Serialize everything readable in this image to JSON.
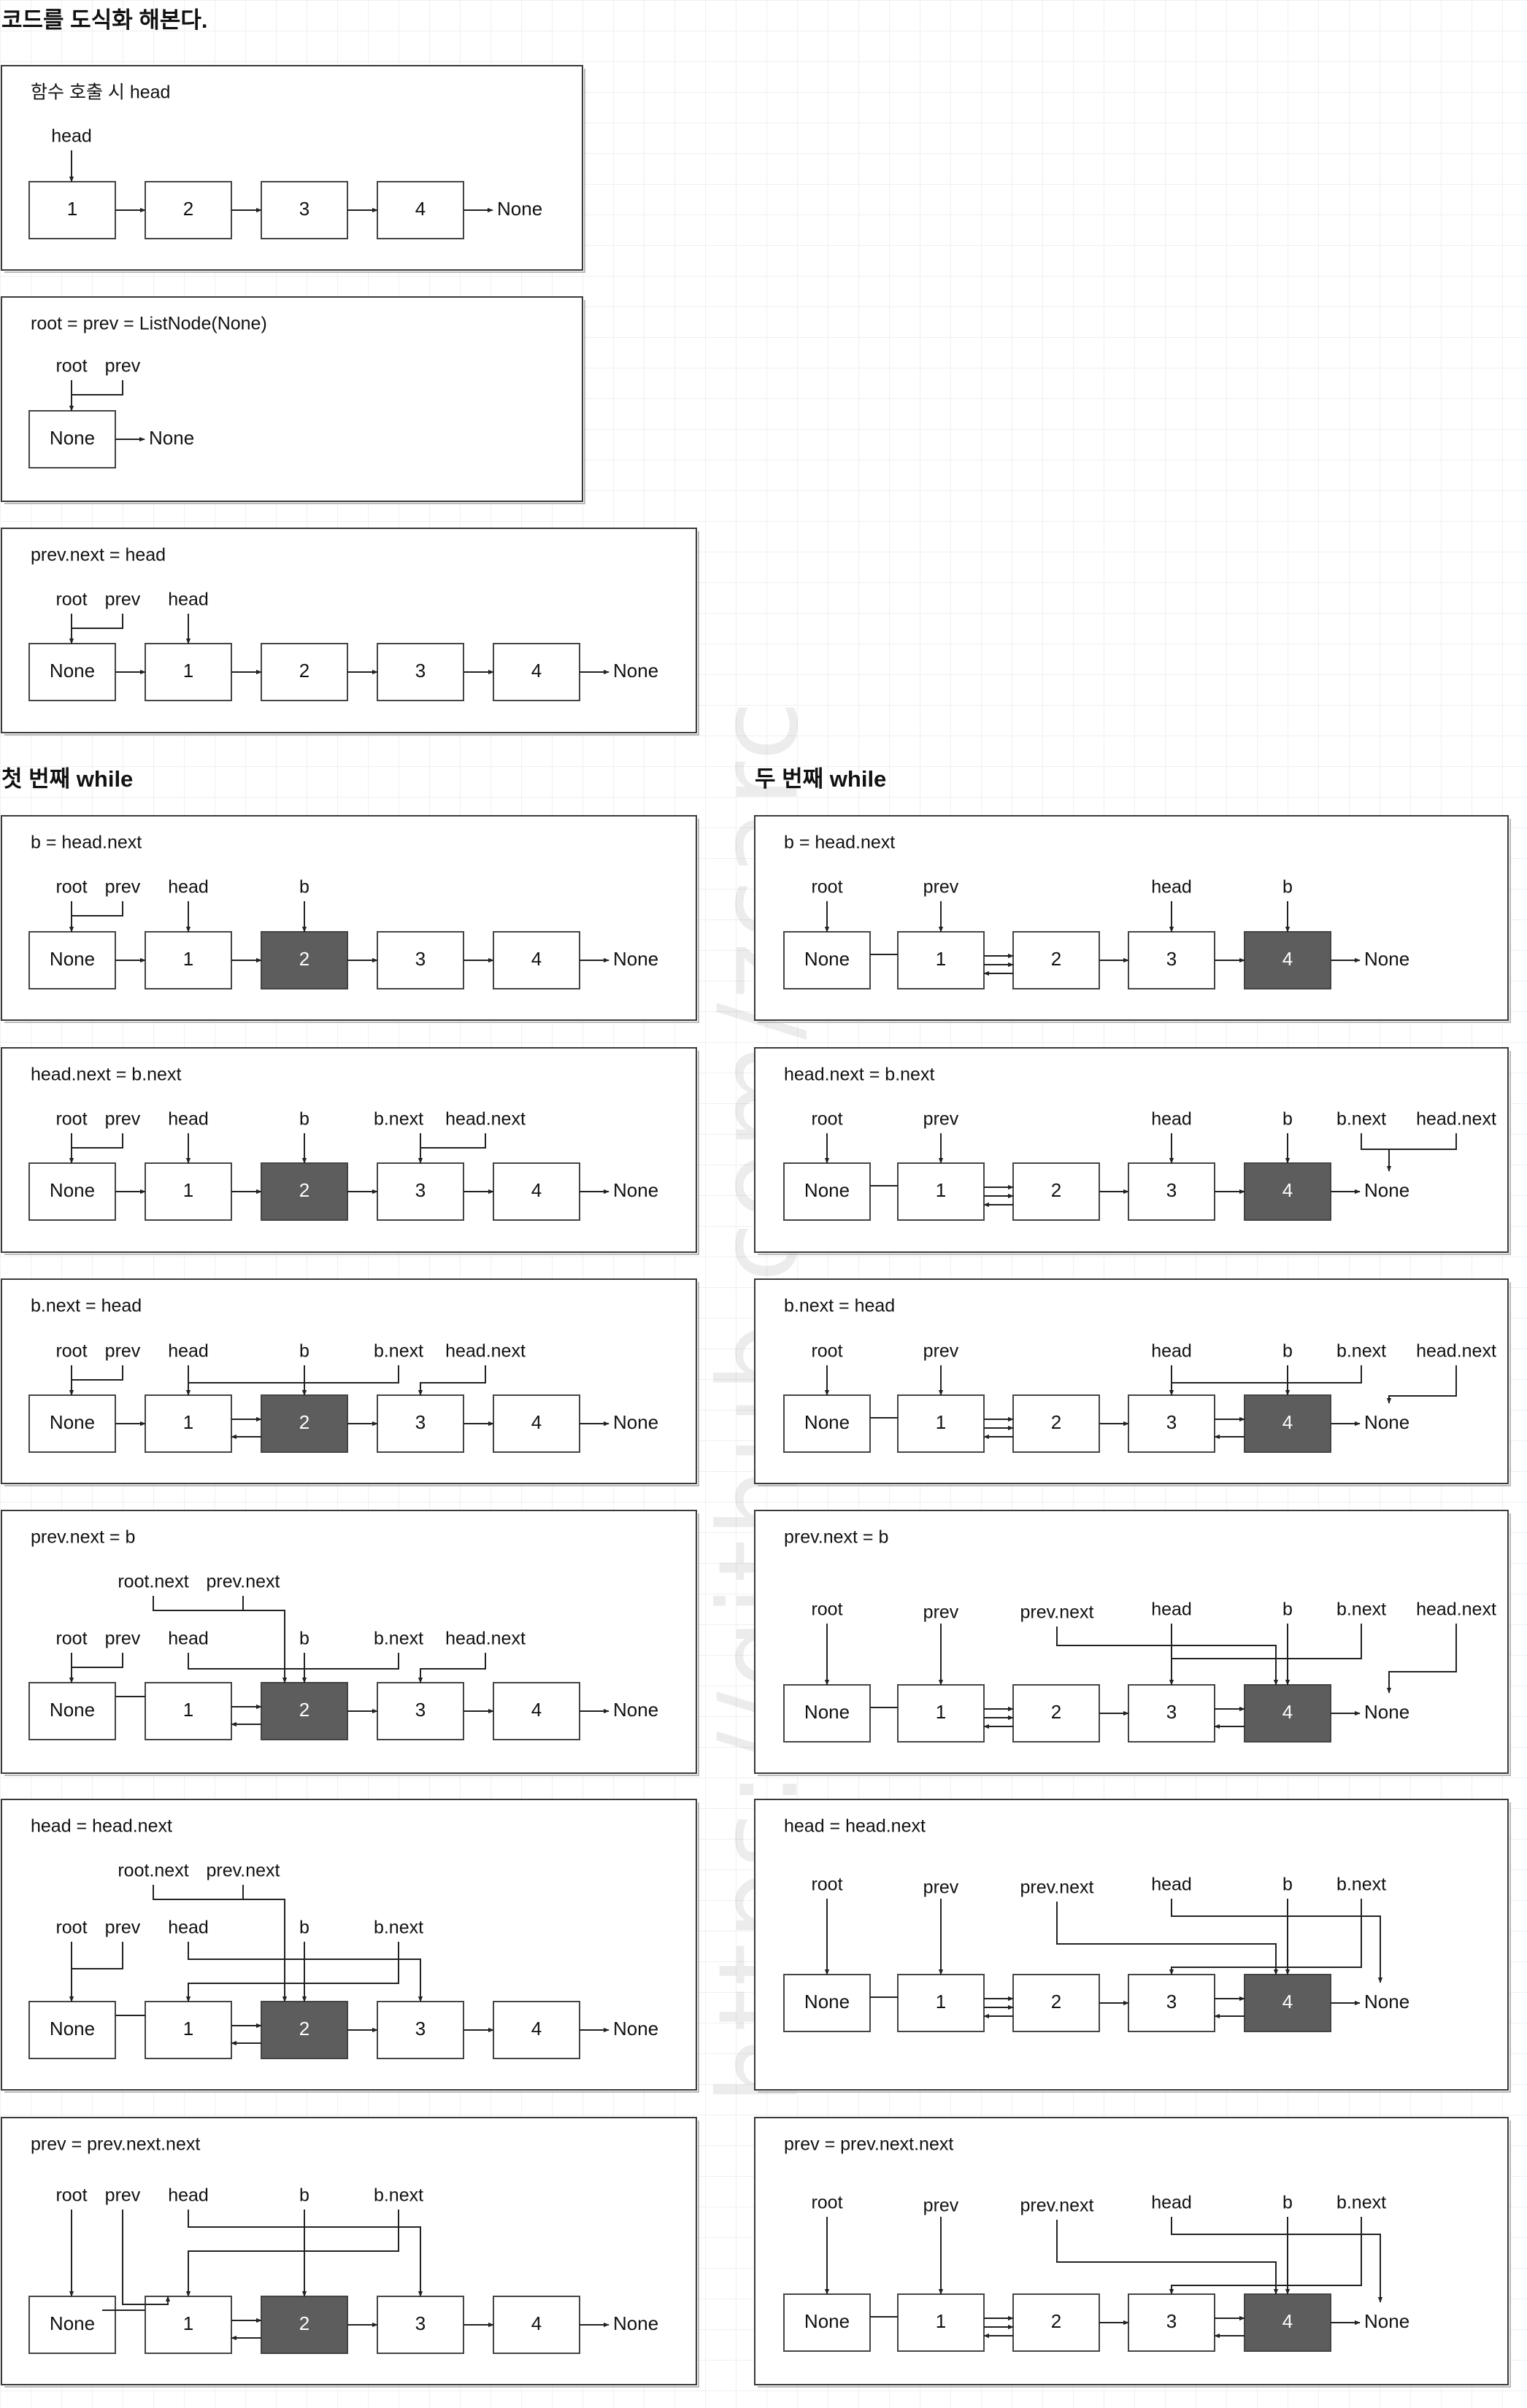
{
  "page_title": "코드를 도식화 해본다.",
  "section_titles": {
    "first_while": "첫 번째 while",
    "second_while": "두 번째 while"
  },
  "watermark": "https://github.com/zcarc",
  "colors": {
    "highlight_node": "#5d5d5d",
    "panel_border": "#3a3a3a",
    "line": "#222222"
  },
  "panels": [
    {
      "id": "call",
      "title": "함수 호출 시 head",
      "nodes": [
        "1",
        "2",
        "3",
        "4"
      ],
      "highlight": [],
      "terminal": "None",
      "labels": [
        "head"
      ]
    },
    {
      "id": "init",
      "title": "root = prev = ListNode(None)",
      "nodes": [
        "None"
      ],
      "highlight": [],
      "terminal": "None",
      "labels": [
        "root",
        "prev"
      ]
    },
    {
      "id": "link",
      "title": "prev.next = head",
      "nodes": [
        "None",
        "1",
        "2",
        "3",
        "4"
      ],
      "highlight": [],
      "terminal": "None",
      "labels": [
        "root",
        "prev",
        "head"
      ]
    },
    {
      "id": "w1_1",
      "title": "b = head.next",
      "nodes": [
        "None",
        "1",
        "2",
        "3",
        "4"
      ],
      "highlight": [
        2
      ],
      "terminal": "None",
      "labels": [
        "root",
        "prev",
        "head",
        "b"
      ]
    },
    {
      "id": "w1_2",
      "title": "head.next = b.next",
      "nodes": [
        "None",
        "1",
        "2",
        "3",
        "4"
      ],
      "highlight": [
        2
      ],
      "terminal": "None",
      "labels": [
        "root",
        "prev",
        "head",
        "b",
        "b.next",
        "head.next"
      ]
    },
    {
      "id": "w1_3",
      "title": "b.next = head",
      "nodes": [
        "None",
        "1",
        "2",
        "3",
        "4"
      ],
      "highlight": [
        2
      ],
      "terminal": "None",
      "labels": [
        "root",
        "prev",
        "head",
        "b",
        "b.next",
        "head.next"
      ]
    },
    {
      "id": "w1_4",
      "title": "prev.next = b",
      "nodes": [
        "None",
        "1",
        "2",
        "3",
        "4"
      ],
      "highlight": [
        2
      ],
      "terminal": "None",
      "labels": [
        "root.next",
        "prev.next",
        "root",
        "prev",
        "head",
        "b",
        "b.next",
        "head.next"
      ]
    },
    {
      "id": "w1_5",
      "title": "head = head.next",
      "nodes": [
        "None",
        "1",
        "2",
        "3",
        "4"
      ],
      "highlight": [
        2
      ],
      "terminal": "None",
      "labels": [
        "root.next",
        "prev.next",
        "root",
        "prev",
        "head",
        "b",
        "b.next"
      ]
    },
    {
      "id": "w1_6",
      "title": "prev = prev.next.next",
      "nodes": [
        "None",
        "1",
        "2",
        "3",
        "4"
      ],
      "highlight": [
        2
      ],
      "terminal": "None",
      "labels": [
        "root",
        "prev",
        "head",
        "b",
        "b.next"
      ]
    },
    {
      "id": "w2_1",
      "title": "b = head.next",
      "nodes": [
        "None",
        "1",
        "2",
        "3",
        "4"
      ],
      "highlight": [
        4
      ],
      "terminal": "None",
      "labels": [
        "root",
        "prev",
        "head",
        "b"
      ]
    },
    {
      "id": "w2_2",
      "title": "head.next = b.next",
      "nodes": [
        "None",
        "1",
        "2",
        "3",
        "4"
      ],
      "highlight": [
        4
      ],
      "terminal": "None",
      "labels": [
        "root",
        "prev",
        "head",
        "b",
        "b.next",
        "head.next"
      ]
    },
    {
      "id": "w2_3",
      "title": "b.next = head",
      "nodes": [
        "None",
        "1",
        "2",
        "3",
        "4"
      ],
      "highlight": [
        4
      ],
      "terminal": "None",
      "labels": [
        "root",
        "prev",
        "head",
        "b",
        "b.next",
        "head.next"
      ]
    },
    {
      "id": "w2_4",
      "title": "prev.next = b",
      "nodes": [
        "None",
        "1",
        "2",
        "3",
        "4"
      ],
      "highlight": [
        4
      ],
      "terminal": "None",
      "labels": [
        "root",
        "prev",
        "prev.next",
        "head",
        "b",
        "b.next",
        "head.next"
      ]
    },
    {
      "id": "w2_5",
      "title": "head = head.next",
      "nodes": [
        "None",
        "1",
        "2",
        "3",
        "4"
      ],
      "highlight": [
        4
      ],
      "terminal": "None",
      "labels": [
        "root",
        "prev",
        "prev.next",
        "head",
        "b",
        "b.next"
      ]
    },
    {
      "id": "w2_6",
      "title": "prev = prev.next.next",
      "nodes": [
        "None",
        "1",
        "2",
        "3",
        "4"
      ],
      "highlight": [
        4
      ],
      "terminal": "None",
      "labels": [
        "root",
        "prev",
        "prev.next",
        "head",
        "b",
        "b.next"
      ]
    }
  ]
}
